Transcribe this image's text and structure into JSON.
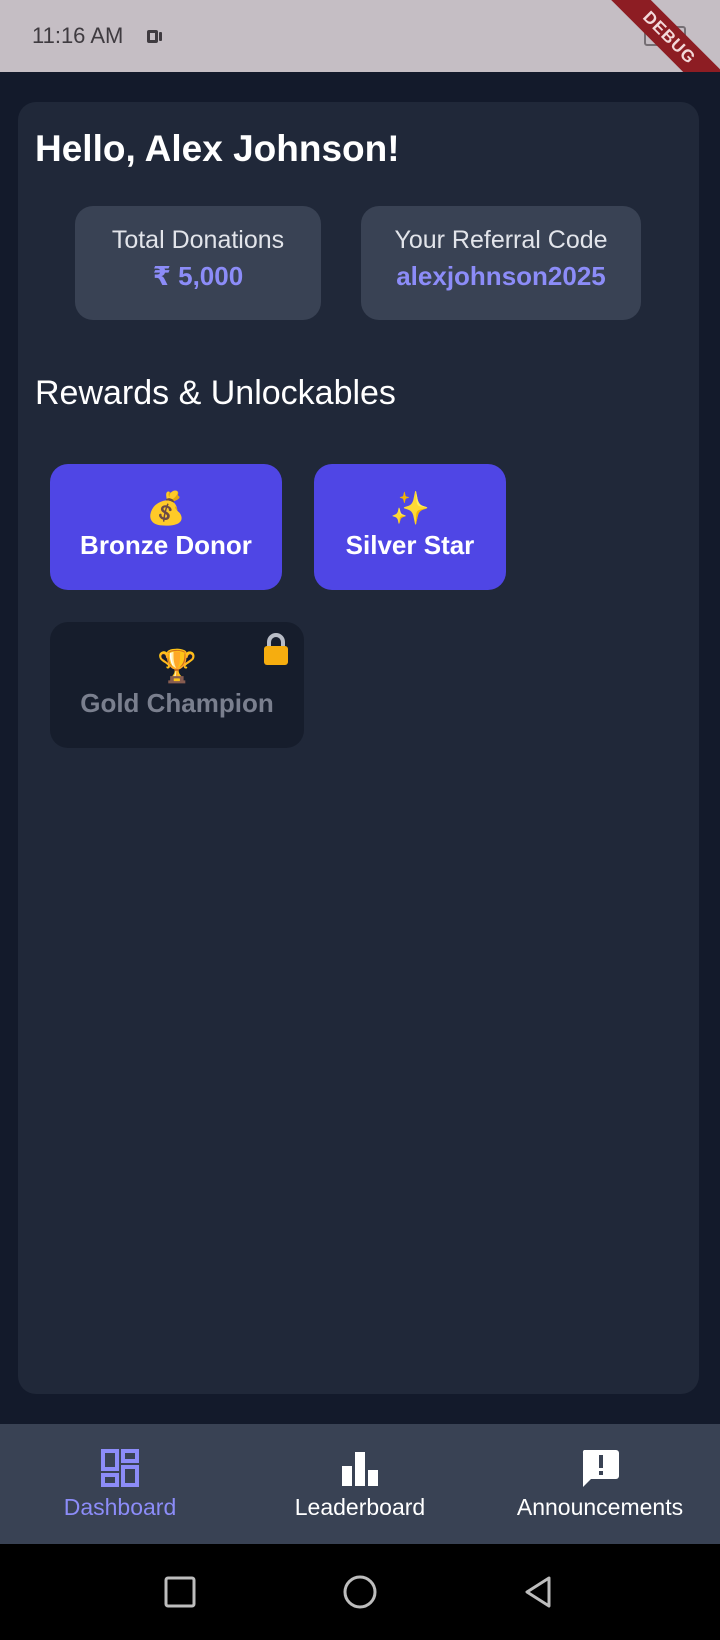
{
  "status_bar": {
    "time": "11:16 AM",
    "debug_label": "DEBUG"
  },
  "header": {
    "greeting": "Hello, Alex Johnson!"
  },
  "stats": {
    "donations": {
      "label": "Total Donations",
      "value": "₹ 5,000"
    },
    "referral": {
      "label": "Your Referral Code",
      "value": "alexjohnson2025"
    }
  },
  "rewards": {
    "title": "Rewards & Unlockables",
    "items": [
      {
        "emoji": "💰",
        "label": "Bronze Donor",
        "locked": false
      },
      {
        "emoji": "✨",
        "label": "Silver Star",
        "locked": false
      },
      {
        "emoji": "🏆",
        "label": "Gold Champion",
        "locked": true
      }
    ]
  },
  "bottom_nav": {
    "items": [
      {
        "label": "Dashboard",
        "icon": "dashboard-icon",
        "active": true
      },
      {
        "label": "Leaderboard",
        "icon": "leaderboard-icon",
        "active": false
      },
      {
        "label": "Announcements",
        "icon": "announcement-icon",
        "active": false
      }
    ]
  },
  "colors": {
    "accent": "#4f46e5",
    "accent_text": "#8c8cf8",
    "background": "#131a2b",
    "card": "#202839",
    "lock": "#f6ad0f"
  }
}
